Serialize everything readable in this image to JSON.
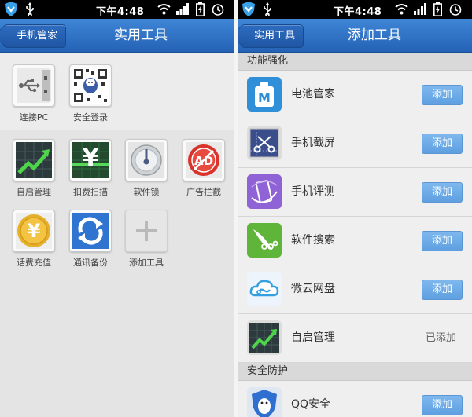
{
  "status_bar": {
    "time": "下午4:48"
  },
  "left_screen": {
    "back_label": "手机管家",
    "title": "实用工具",
    "top_tools": [
      {
        "label": "连接PC",
        "icon": "usb-drive-icon"
      },
      {
        "label": "安全登录",
        "icon": "qr-code-icon"
      }
    ],
    "tools": [
      {
        "label": "自启管理",
        "icon": "startup-chart-icon"
      },
      {
        "label": "扣费扫描",
        "icon": "yen-scan-icon"
      },
      {
        "label": "软件锁",
        "icon": "dial-lock-icon"
      },
      {
        "label": "广告拦截",
        "icon": "ad-block-icon"
      },
      {
        "label": "话费充值",
        "icon": "yen-coin-icon"
      },
      {
        "label": "通讯备份",
        "icon": "sync-arrows-icon"
      },
      {
        "label": "添加工具",
        "icon": "plus-icon"
      }
    ]
  },
  "right_screen": {
    "back_label": "实用工具",
    "title": "添加工具",
    "sections": [
      {
        "header": "功能强化",
        "items": [
          {
            "name": "电池管家",
            "action": "添加",
            "icon": "battery-m-icon"
          },
          {
            "name": "手机截屏",
            "action": "添加",
            "icon": "scissors-icon"
          },
          {
            "name": "手机评测",
            "action": "添加",
            "icon": "phone-test-icon"
          },
          {
            "name": "软件搜索",
            "action": "添加",
            "icon": "pea-pod-icon"
          },
          {
            "name": "微云网盘",
            "action": "添加",
            "icon": "cloud-icon"
          },
          {
            "name": "自启管理",
            "action": "已添加",
            "icon": "startup-chart-icon"
          }
        ]
      },
      {
        "header": "安全防护",
        "items": [
          {
            "name": "QQ安全",
            "action": "添加",
            "icon": "qq-shield-icon"
          }
        ]
      }
    ]
  },
  "colors": {
    "titlebar": "#2f72c6",
    "add_button": "#6eaae6",
    "status_bar": "#000000"
  }
}
